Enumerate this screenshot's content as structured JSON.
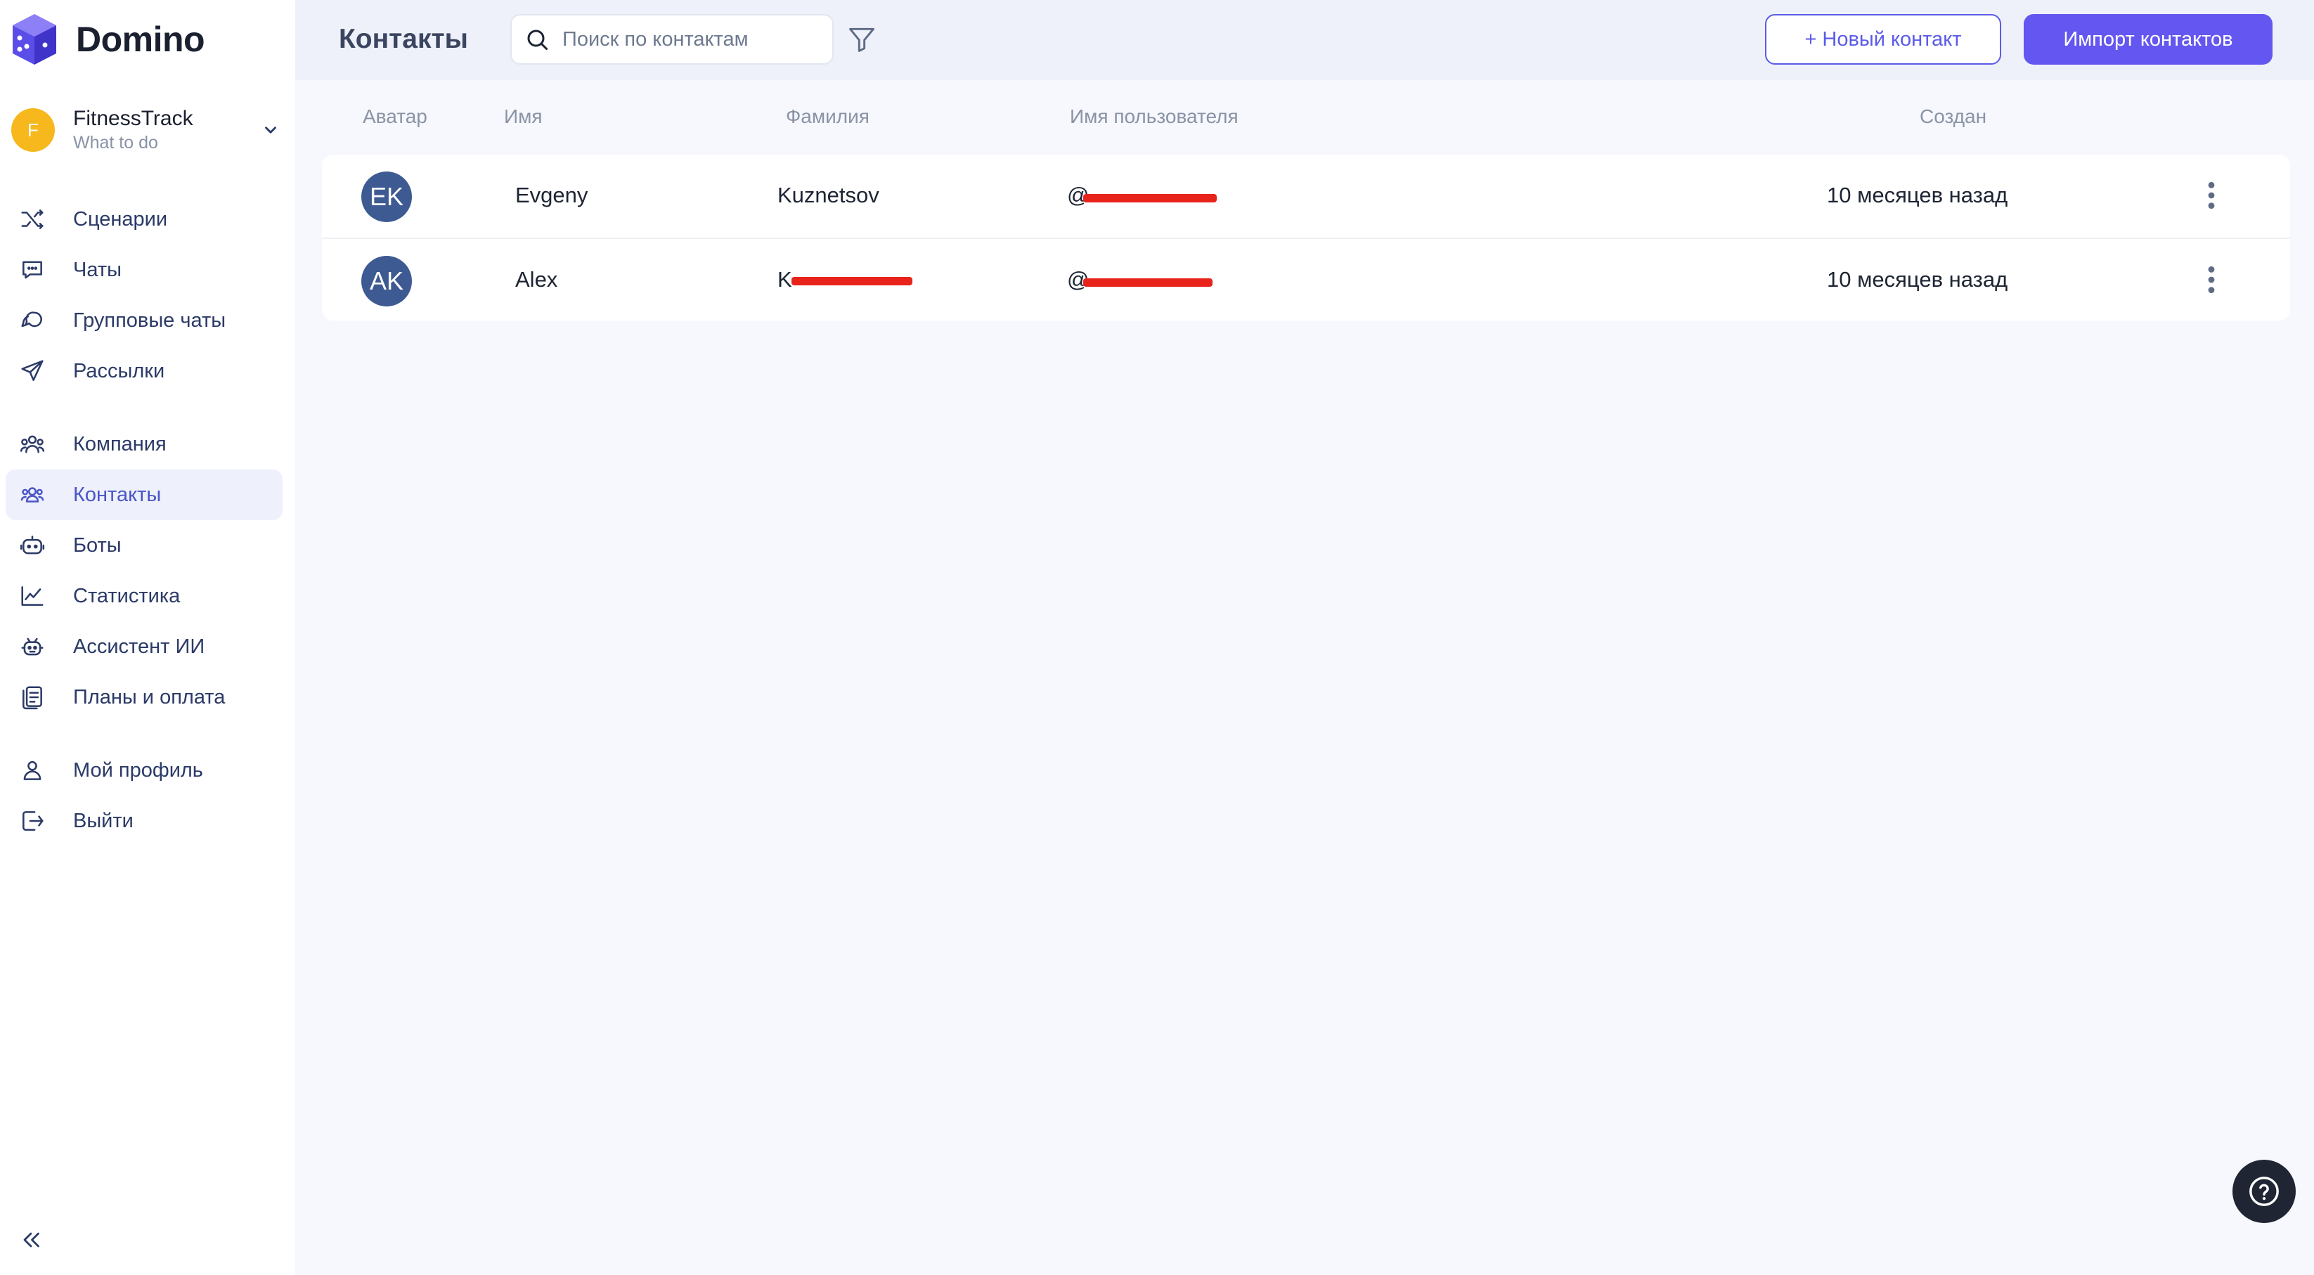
{
  "app": {
    "name": "Domino"
  },
  "workspace": {
    "initial": "F",
    "name": "FitnessTrack",
    "subtitle": "What to do"
  },
  "sidebar": {
    "items": [
      {
        "label": "Сценарии",
        "icon": "shuffle-icon"
      },
      {
        "label": "Чаты",
        "icon": "chat-icon"
      },
      {
        "label": "Групповые чаты",
        "icon": "group-chat-icon"
      },
      {
        "label": "Рассылки",
        "icon": "send-icon"
      },
      {
        "label": "Компания",
        "icon": "company-icon"
      },
      {
        "label": "Контакты",
        "icon": "contacts-icon",
        "active": true
      },
      {
        "label": "Боты",
        "icon": "bot-icon"
      },
      {
        "label": "Статистика",
        "icon": "chart-icon"
      },
      {
        "label": "Ассистент ИИ",
        "icon": "ai-assistant-icon"
      },
      {
        "label": "Планы и оплата",
        "icon": "billing-icon"
      },
      {
        "label": "Мой профиль",
        "icon": "profile-icon"
      },
      {
        "label": "Выйти",
        "icon": "logout-icon"
      }
    ]
  },
  "header": {
    "title": "Контакты",
    "search_placeholder": "Поиск по контактам",
    "new_contact_label": "+ Новый контакт",
    "import_label": "Импорт контактов"
  },
  "table": {
    "columns": [
      "Аватар",
      "Имя",
      "Фамилия",
      "Имя пользователя",
      "Создан"
    ],
    "rows": [
      {
        "initials": "EK",
        "first_name": "Evgeny",
        "last_name": "Kuznetsov",
        "username": "@",
        "created": "10 месяцев назад"
      },
      {
        "initials": "AK",
        "first_name": "Alex",
        "last_name": "K",
        "username": "@",
        "created": "10 месяцев назад"
      }
    ]
  },
  "colors": {
    "accent": "#6456f0",
    "active_nav_bg": "#eef0fb",
    "avatar_bg": "#3e5a92",
    "workspace_avatar": "#f6b81c",
    "redaction": "#e8231b"
  }
}
